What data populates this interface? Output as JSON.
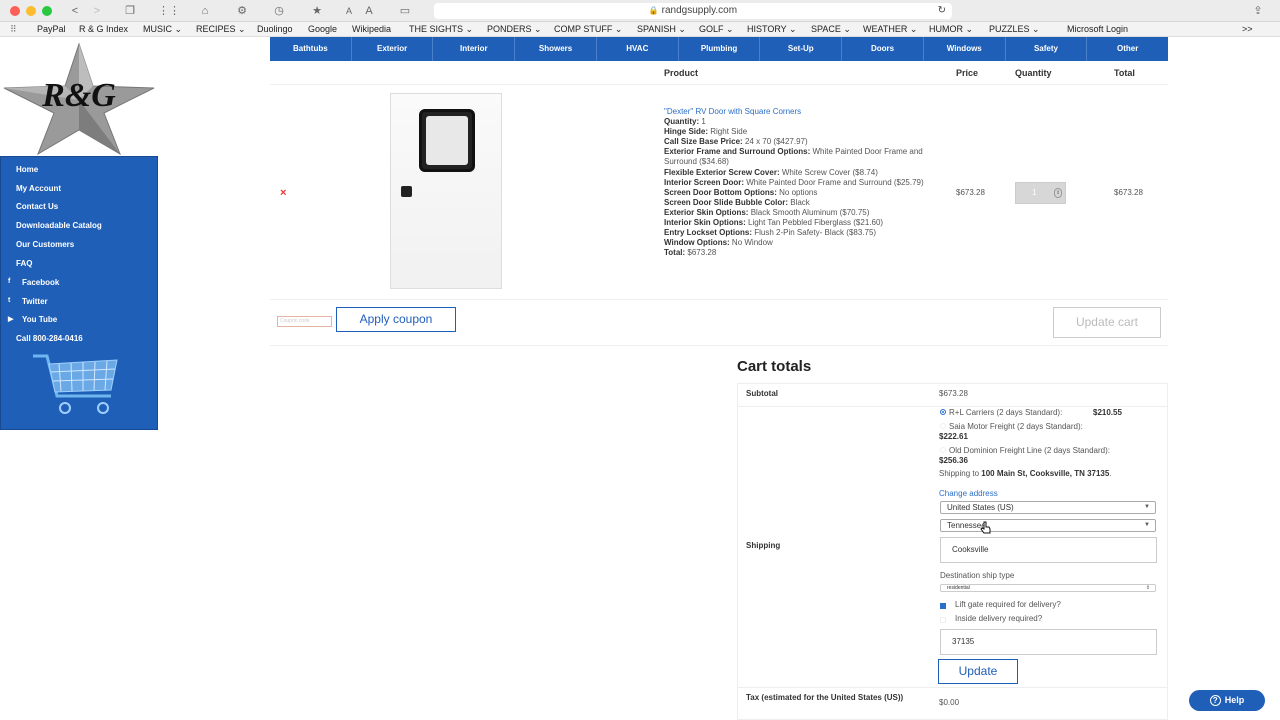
{
  "browser": {
    "url": "randgsupply.com",
    "buttons": {
      "back": "<",
      "forward": ">",
      "text_small": "A",
      "text_large": "A"
    },
    "bookmarks": [
      {
        "label": "PayPal"
      },
      {
        "label": "R & G Index"
      },
      {
        "label": "MUSIC ⌄"
      },
      {
        "label": "RECIPES ⌄"
      },
      {
        "label": "Duolingo"
      },
      {
        "label": "Google"
      },
      {
        "label": "Wikipedia"
      },
      {
        "label": "THE SIGHTS ⌄"
      },
      {
        "label": "PONDERS ⌄"
      },
      {
        "label": "COMP STUFF ⌄"
      },
      {
        "label": "SPANISH ⌄"
      },
      {
        "label": "GOLF ⌄"
      },
      {
        "label": "HISTORY ⌄"
      },
      {
        "label": "SPACE ⌄"
      },
      {
        "label": "WEATHER ⌄"
      },
      {
        "label": "HUMOR ⌄"
      },
      {
        "label": "PUZZLES ⌄"
      },
      {
        "label": "Microsoft Login"
      }
    ],
    "more": ">>"
  },
  "topnav": [
    "Bathtubs",
    "Exterior",
    "Interior",
    "Showers",
    "HVAC",
    "Plumbing",
    "Set-Up",
    "Doors",
    "Windows",
    "Safety",
    "Other"
  ],
  "logo": {
    "letters": "R&G"
  },
  "sidebar": {
    "items": [
      {
        "label": "Home",
        "icon": ""
      },
      {
        "label": "My Account",
        "icon": ""
      },
      {
        "label": "Contact Us",
        "icon": ""
      },
      {
        "label": "Downloadable Catalog",
        "icon": ""
      },
      {
        "label": "Our Customers",
        "icon": ""
      },
      {
        "label": "FAQ",
        "icon": ""
      },
      {
        "label": "Facebook",
        "icon": "f"
      },
      {
        "label": "Twitter",
        "icon": "t"
      },
      {
        "label": "You Tube",
        "icon": "▶"
      },
      {
        "label": "Call 800-284-0416",
        "icon": ""
      }
    ]
  },
  "cart_table": {
    "headers": {
      "product": "Product",
      "price": "Price",
      "quantity": "Quantity",
      "total": "Total"
    },
    "remove": "×",
    "item": {
      "title": "\"Dexter\" RV Door with Square Corners",
      "options": [
        {
          "k": "Quantity:",
          "v": " 1"
        },
        {
          "k": "Hinge Side:",
          "v": " Right Side"
        },
        {
          "k": "Call Size Base Price:",
          "v": " 24 x 70 ($427.97)"
        },
        {
          "k": "Exterior Frame and Surround Options:",
          "v": " White Painted Door Frame and Surround ($34.68)"
        },
        {
          "k": "Flexible Exterior Screw Cover:",
          "v": " White Screw Cover ($8.74)"
        },
        {
          "k": "Interior Screen Door:",
          "v": " White Painted Door Frame and Surround ($25.79)"
        },
        {
          "k": "Screen Door Bottom Options:",
          "v": " No options"
        },
        {
          "k": "Screen Door Slide Bubble Color:",
          "v": " Black"
        },
        {
          "k": "Exterior Skin Options:",
          "v": " Black Smooth Aluminum ($70.75)"
        },
        {
          "k": "Interior Skin Options:",
          "v": " Light Tan Pebbled Fiberglass ($21.60)"
        },
        {
          "k": "Entry Lockset Options:",
          "v": " Flush 2-Pin Safety- Black ($83.75)"
        },
        {
          "k": "Window Options:",
          "v": " No Window"
        },
        {
          "k": "Total:",
          "v": " $673.28"
        }
      ],
      "price": "$673.28",
      "quantity": "1",
      "total": "$673.28"
    },
    "coupon_placeholder": "Coupon code",
    "apply_coupon": "Apply coupon",
    "update_cart": "Update cart"
  },
  "cart_totals": {
    "heading": "Cart totals",
    "subtotal_label": "Subtotal",
    "subtotal_value": "$673.28",
    "shipping_label": "Shipping",
    "options": [
      {
        "name": "R+L Carriers (2 days Standard):",
        "price": "$210.55",
        "selected": true
      },
      {
        "name": "Saia Motor Freight (2 days Standard):",
        "price": "$222.61",
        "selected": false
      },
      {
        "name": "Old Dominion Freight Line (2 days Standard):",
        "price": "$256.36",
        "selected": false
      }
    ],
    "ship_to_prefix": "Shipping to ",
    "ship_to_address": "100 Main St, Cooksville, TN 37135",
    "ship_to_suffix": ".",
    "change_address": "Change address",
    "country": "United States (US)",
    "state": "Tennessee",
    "city": "Cooksville",
    "dest_type_label": "Destination ship type",
    "dest_type": "residential",
    "liftgate_label": "Lift gate required for delivery?",
    "liftgate_checked": true,
    "inside_label": "Inside delivery required?",
    "inside_checked": false,
    "zip": "37135",
    "update": "Update",
    "tax_label": "Tax (estimated for the United States (US))",
    "tax_value": "$0.00"
  },
  "help": {
    "label": "Help",
    "icon": "?"
  },
  "colors": {
    "brand_blue": "#1f5fb8",
    "link_blue": "#2a6fc9",
    "remove_red": "#e33333"
  }
}
